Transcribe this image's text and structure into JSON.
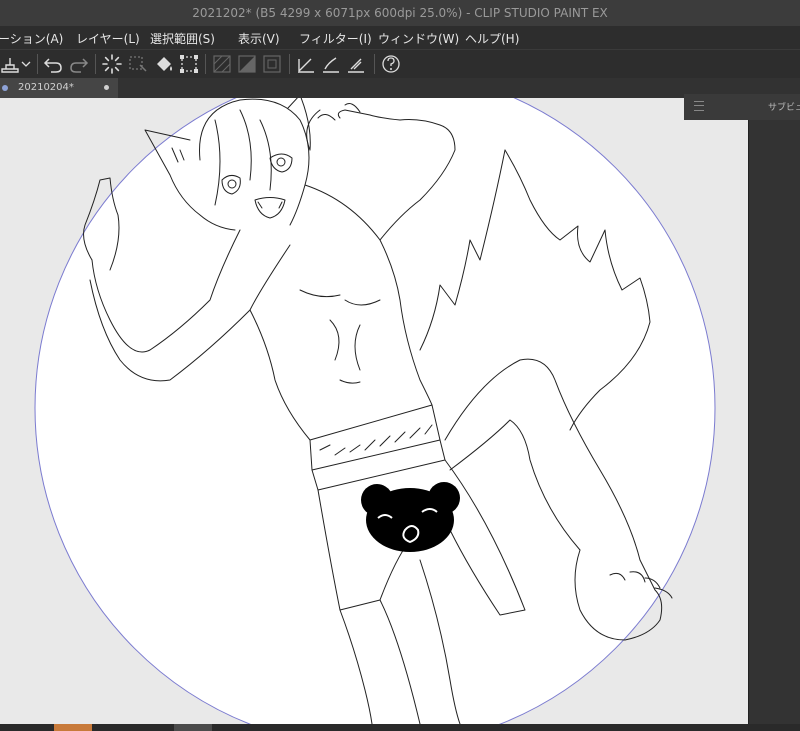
{
  "window": {
    "title": "2021202* (B5 4299 x 6071px 600dpi 25.0%)  - CLIP STUDIO PAINT EX"
  },
  "menu": {
    "items": [
      "ーション(A)",
      "レイヤー(L)",
      "選択範囲(S)",
      "表示(V)",
      "フィルター(I)",
      "ウィンドウ(W)",
      "ヘルプ(H)"
    ]
  },
  "toolbar": {
    "icons": [
      "stamp-icon",
      "dropdown-chevron-icon",
      "undo-icon",
      "redo-icon",
      "loading-spinner-icon",
      "transform-select-icon",
      "fill-bucket-icon",
      "bounding-box-icon",
      "grid-toggle-icon",
      "layer-mask-icon",
      "ruler-icon",
      "brush-adjust-icon",
      "brush-size-icon",
      "ruler-adjust-icon",
      "help-icon"
    ]
  },
  "tabs": [
    {
      "label": "20210204*"
    }
  ],
  "subview": {
    "label": "サブビュー"
  },
  "colors": {
    "canvas_bg": "#e9e9e9",
    "circle_stroke": "#7b7bd0",
    "accent_orange": "#c87a3a",
    "sticker": "#000000"
  }
}
